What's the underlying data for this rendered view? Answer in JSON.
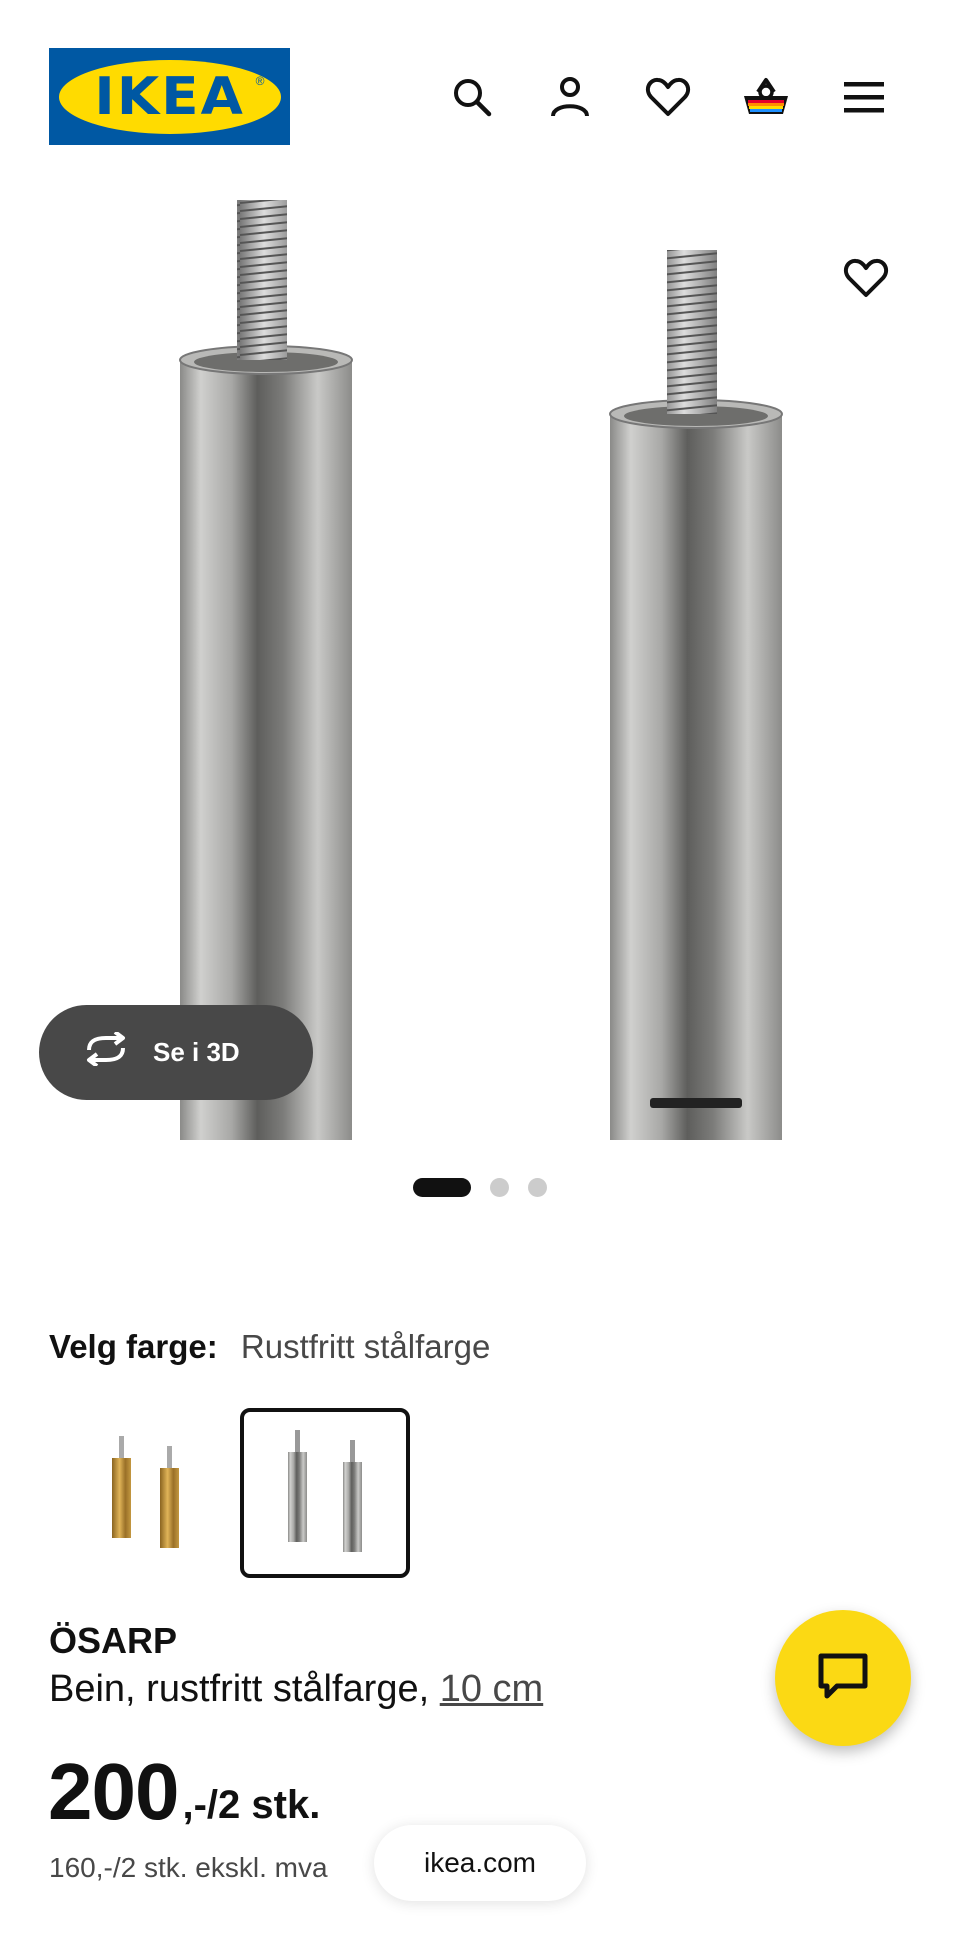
{
  "header": {
    "logo_text": "IKEA",
    "logo_registered": "®",
    "icons": [
      "search-icon",
      "account-icon",
      "favorites-icon",
      "cart-icon",
      "menu-icon"
    ]
  },
  "gallery": {
    "view_3d_label": "Se i 3D",
    "slide_count": 3,
    "active_slide": 1
  },
  "color_selector": {
    "label": "Velg farge:",
    "selected": "Rustfritt stålfarge",
    "options": [
      "brass",
      "stainless-steel"
    ]
  },
  "product": {
    "name": "ÖSARP",
    "description": "Bein, rustfritt stålfarge, ",
    "size": "10 cm",
    "price_main": "200",
    "price_suffix": ",-/2 stk.",
    "price_ex_vat": "160,-/2 stk. ekskl. mva"
  },
  "browser": {
    "url": "ikea.com"
  },
  "colors": {
    "ikea_blue": "#0058a3",
    "ikea_yellow": "#ffdb00",
    "chat_yellow": "#fbd914"
  }
}
